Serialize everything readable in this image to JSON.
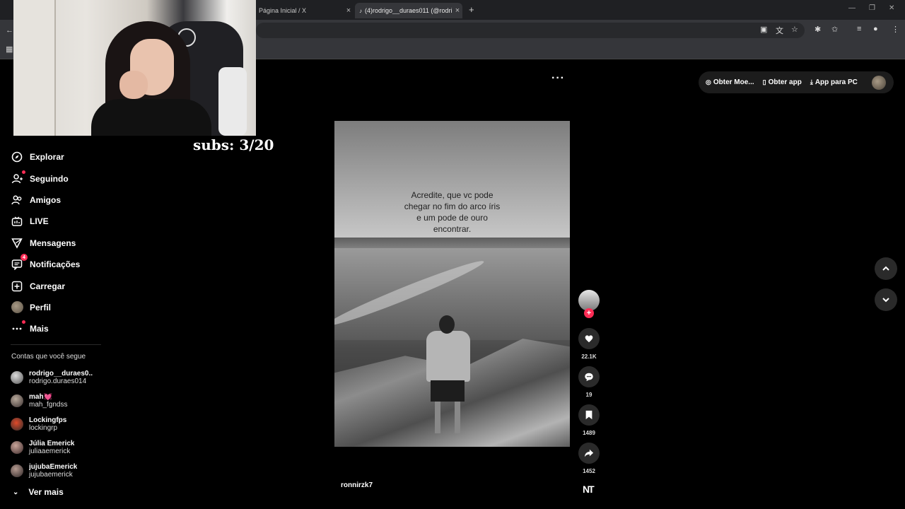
{
  "browser": {
    "tabs": [
      {
        "title": "Página Inicial / X"
      },
      {
        "title": "(4)rodrigo__duraes011 (@rodri"
      }
    ]
  },
  "overlay": {
    "subs_text": "subs: 3/20"
  },
  "sidebar": {
    "items": [
      {
        "label": "Explorar",
        "icon": "compass-icon"
      },
      {
        "label": "Seguindo",
        "icon": "following-icon"
      },
      {
        "label": "Amigos",
        "icon": "friends-icon"
      },
      {
        "label": "LIVE",
        "icon": "live-icon"
      },
      {
        "label": "Mensagens",
        "icon": "messages-icon"
      },
      {
        "label": "Notificações",
        "icon": "notifications-icon",
        "badge": "4"
      },
      {
        "label": "Carregar",
        "icon": "upload-icon"
      },
      {
        "label": "Perfil",
        "icon": "avatar"
      },
      {
        "label": "Mais",
        "icon": "more-icon"
      }
    ],
    "following_title": "Contas que você segue",
    "following": [
      {
        "name": "rodrigo__duraes0...",
        "user": "rodrigo.duraes014"
      },
      {
        "name": "mah💓",
        "user": "mah_fgndss"
      },
      {
        "name": "Lockingfps",
        "user": "lockingrp"
      },
      {
        "name": "Júlia Emerick",
        "user": "juliaaemerick"
      },
      {
        "name": "jujubaEmerick",
        "user": "jujubaemerick"
      }
    ],
    "see_more": "Ver mais"
  },
  "header": {
    "get_coins": "Obter Moe...",
    "get_app": "Obter app",
    "app_pc": "App para PC"
  },
  "video": {
    "caption": "Acredite, que vc pode\nchegar no fim do arco íris\ne um pode de ouro\nencontrar.",
    "author": "ronnirzk7",
    "likes": "22.1K",
    "comments": "19",
    "saves": "1489",
    "shares": "1452"
  },
  "colors": {
    "accent": "#fe2c55",
    "background": "#000000"
  }
}
